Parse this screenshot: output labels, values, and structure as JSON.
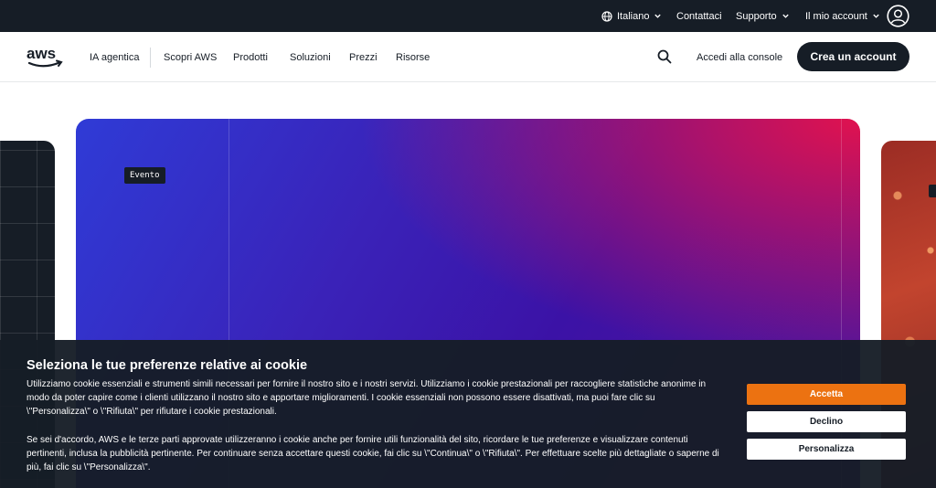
{
  "topbar": {
    "language": "Italiano",
    "contact": "Contattaci",
    "support": "Supporto",
    "account": "Il mio account"
  },
  "nav": {
    "logo_text": "aws",
    "items": [
      "IA agentica",
      "Scopri AWS",
      "Prodotti",
      "Soluzioni",
      "Prezzi",
      "Risorse"
    ],
    "console": "Accedi alla console",
    "cta": "Crea un account"
  },
  "hero": {
    "badge": "Evento"
  },
  "cookie": {
    "title": "Seleziona le tue preferenze relative ai cookie",
    "para1": "Utilizziamo cookie essenziali e strumenti simili necessari per fornire il nostro sito e i nostri servizi. Utilizziamo i cookie prestazionali per raccogliere statistiche anonime in modo da poter capire come i clienti utilizzano il nostro sito e apportare miglioramenti. I cookie essenziali non possono essere disattivati, ma puoi fare clic su \\\"Personalizza\\\" o \\\"Rifiuta\\\" per rifiutare i cookie prestazionali.",
    "para2": "Se sei d'accordo, AWS e le terze parti approvate utilizzeranno i cookie anche per fornire utili funzionalità del sito, ricordare le tue preferenze e visualizzare contenuti pertinenti, inclusa la pubblicità pertinente. Per continuare senza accettare questi cookie, fai clic su \\\"Continua\\\" o \\\"Rifiuta\\\". Per effettuare scelte più dettagliate o saperne di più, fai clic su \\\"Personalizza\\\".",
    "accept": "Accetta",
    "decline": "Declino",
    "customize": "Personalizza"
  },
  "colors": {
    "dark": "#161d26",
    "accent": "#ec7211"
  }
}
